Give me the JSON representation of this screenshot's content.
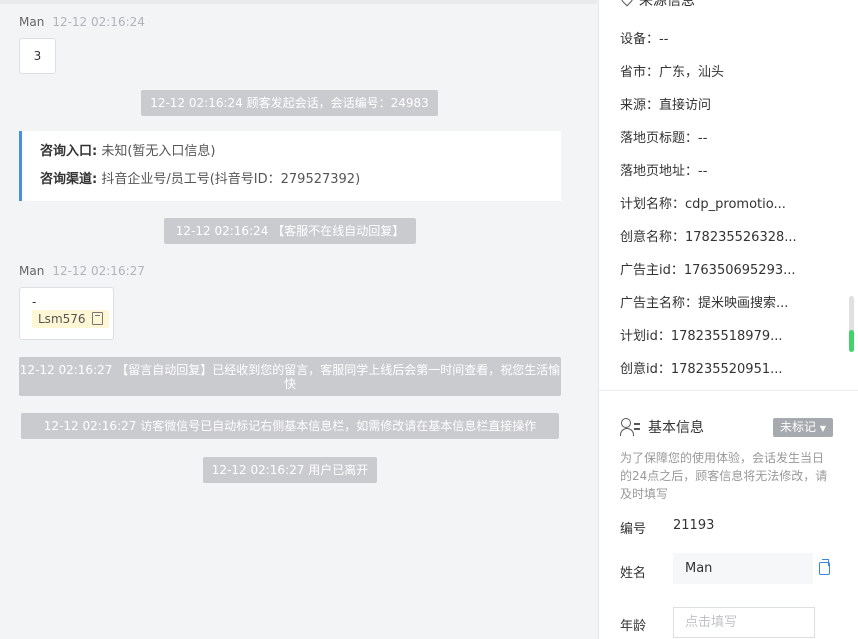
{
  "chat": {
    "messages": [
      {
        "sender": "Man",
        "time": "12-12 02:16:24",
        "text": "3"
      },
      {
        "sender": "Man",
        "time": "12-12 02:16:27",
        "line1": "-",
        "chip": "Lsm576"
      }
    ],
    "system": [
      "12-12 02:16:24 顾客发起会话，会话编号：24983",
      "12-12 02:16:24 【客服不在线自动回复】",
      "12-12 02:16:27 【留言自动回复】已经收到您的留言，客服同学上线后会第一时间查看，祝您生活愉快",
      "12-12 02:16:27 访客微信号已自动标记右侧基本信息栏，如需修改请在基本信息栏直接操作",
      "12-12 02:16:27 用户已离开"
    ],
    "consult": {
      "entry_label": "咨询入口:",
      "entry_value": "未知(暂无入口信息)",
      "channel_label": "咨询渠道:",
      "channel_value": "抖音企业号/员工号(抖音号ID：279527392)"
    }
  },
  "panel": {
    "source_title": "来源信息",
    "source_rows": [
      "设备：--",
      "省市：广东，汕头",
      "来源：直接访问",
      "落地页标题：--",
      "落地页地址：--",
      "计划名称：cdp_promotio...",
      "创意名称：178235526328...",
      "广告主id：176350695293...",
      "广告主名称：提米映画搜索...",
      "计划id：178235518979...",
      "创意id：178235520951..."
    ],
    "basic_title": "基本信息",
    "tag_button": "未标记",
    "notice": "为了保障您的使用体验，会话发生当日的24点之后，顾客信息将无法修改，请及时填写",
    "id_label": "编号",
    "id_value": "21193",
    "name_label": "姓名",
    "name_value": "Man",
    "age_label": "年龄",
    "age_placeholder": "点击填写"
  }
}
